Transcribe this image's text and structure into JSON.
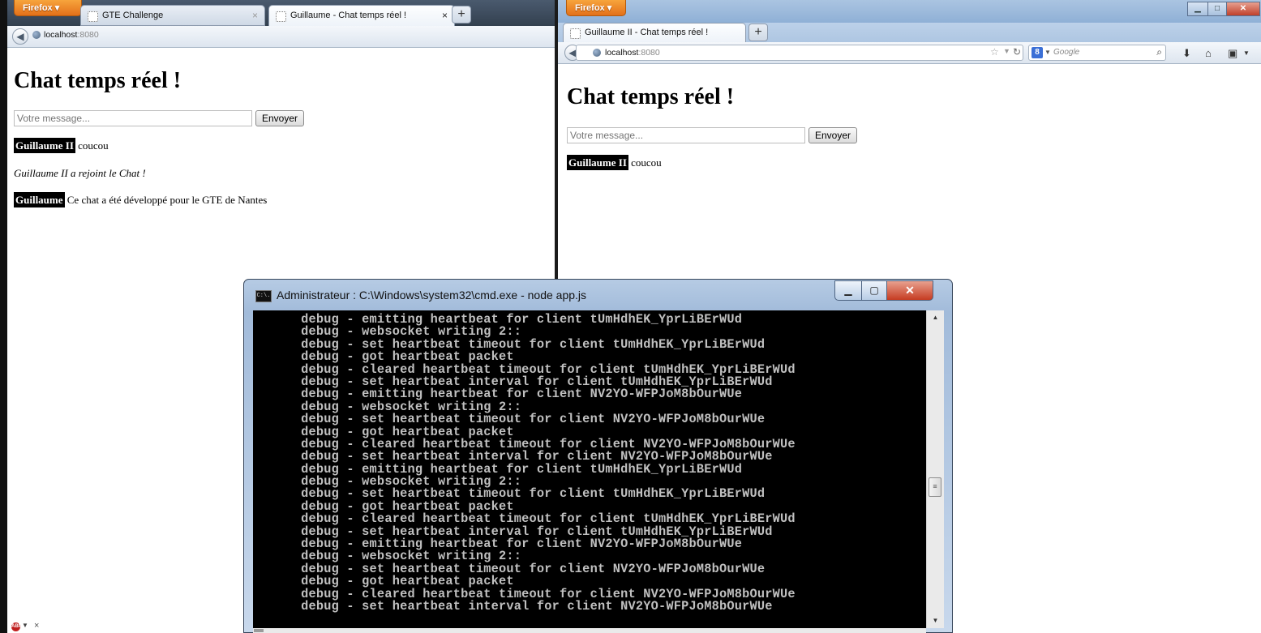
{
  "left_browser": {
    "firefox_button": "Firefox",
    "tabs": [
      {
        "label": "GTE Challenge"
      },
      {
        "label": "Guillaume - Chat temps réel !"
      }
    ],
    "tab_close": "×",
    "new_tab": "+",
    "url_host": "localhost",
    "url_port": ":8080",
    "page": {
      "title": "Chat temps réel !",
      "input_placeholder": "Votre message...",
      "send_label": "Envoyer",
      "messages": [
        {
          "pseudo": "Guillaume II",
          "text": "coucou"
        },
        {
          "system": "Guillaume II a rejoint le Chat !"
        },
        {
          "pseudo": "Guillaume",
          "text": "Ce chat a été développé pour le GTE de Nantes"
        }
      ]
    },
    "statusbar_close": "×"
  },
  "right_browser": {
    "firefox_button": "Firefox",
    "tab_label": "Guillaume II - Chat temps réel !",
    "new_tab": "+",
    "url_host": "localhost",
    "url_port": ":8080",
    "search_placeholder": "Google",
    "page": {
      "title": "Chat temps réel !",
      "input_placeholder": "Votre message...",
      "send_label": "Envoyer",
      "messages": [
        {
          "pseudo": "Guillaume II",
          "text": "coucou"
        }
      ]
    }
  },
  "cmd_window": {
    "title": "Administrateur : C:\\Windows\\system32\\cmd.exe - node  app.js",
    "icon_text": "C:\\.",
    "lines": [
      "   debug - emitting heartbeat for client tUmHdhEK_YprLiBErWUd",
      "   debug - websocket writing 2::",
      "   debug - set heartbeat timeout for client tUmHdhEK_YprLiBErWUd",
      "   debug - got heartbeat packet",
      "   debug - cleared heartbeat timeout for client tUmHdhEK_YprLiBErWUd",
      "   debug - set heartbeat interval for client tUmHdhEK_YprLiBErWUd",
      "   debug - emitting heartbeat for client NV2YO-WFPJoM8bOurWUe",
      "   debug - websocket writing 2::",
      "   debug - set heartbeat timeout for client NV2YO-WFPJoM8bOurWUe",
      "   debug - got heartbeat packet",
      "   debug - cleared heartbeat timeout for client NV2YO-WFPJoM8bOurWUe",
      "   debug - set heartbeat interval for client NV2YO-WFPJoM8bOurWUe",
      "   debug - emitting heartbeat for client tUmHdhEK_YprLiBErWUd",
      "   debug - websocket writing 2::",
      "   debug - set heartbeat timeout for client tUmHdhEK_YprLiBErWUd",
      "   debug - got heartbeat packet",
      "   debug - cleared heartbeat timeout for client tUmHdhEK_YprLiBErWUd",
      "   debug - set heartbeat interval for client tUmHdhEK_YprLiBErWUd",
      "   debug - emitting heartbeat for client NV2YO-WFPJoM8bOurWUe",
      "   debug - websocket writing 2::",
      "   debug - set heartbeat timeout for client NV2YO-WFPJoM8bOurWUe",
      "   debug - got heartbeat packet",
      "   debug - cleared heartbeat timeout for client NV2YO-WFPJoM8bOurWUe",
      "   debug - set heartbeat interval for client NV2YO-WFPJoM8bOurWUe"
    ]
  },
  "colors": {
    "firefox_orange": "#e3701a",
    "pseudo_bg": "#000000",
    "console_bg": "#000000",
    "console_text": "#c0c0c0"
  }
}
